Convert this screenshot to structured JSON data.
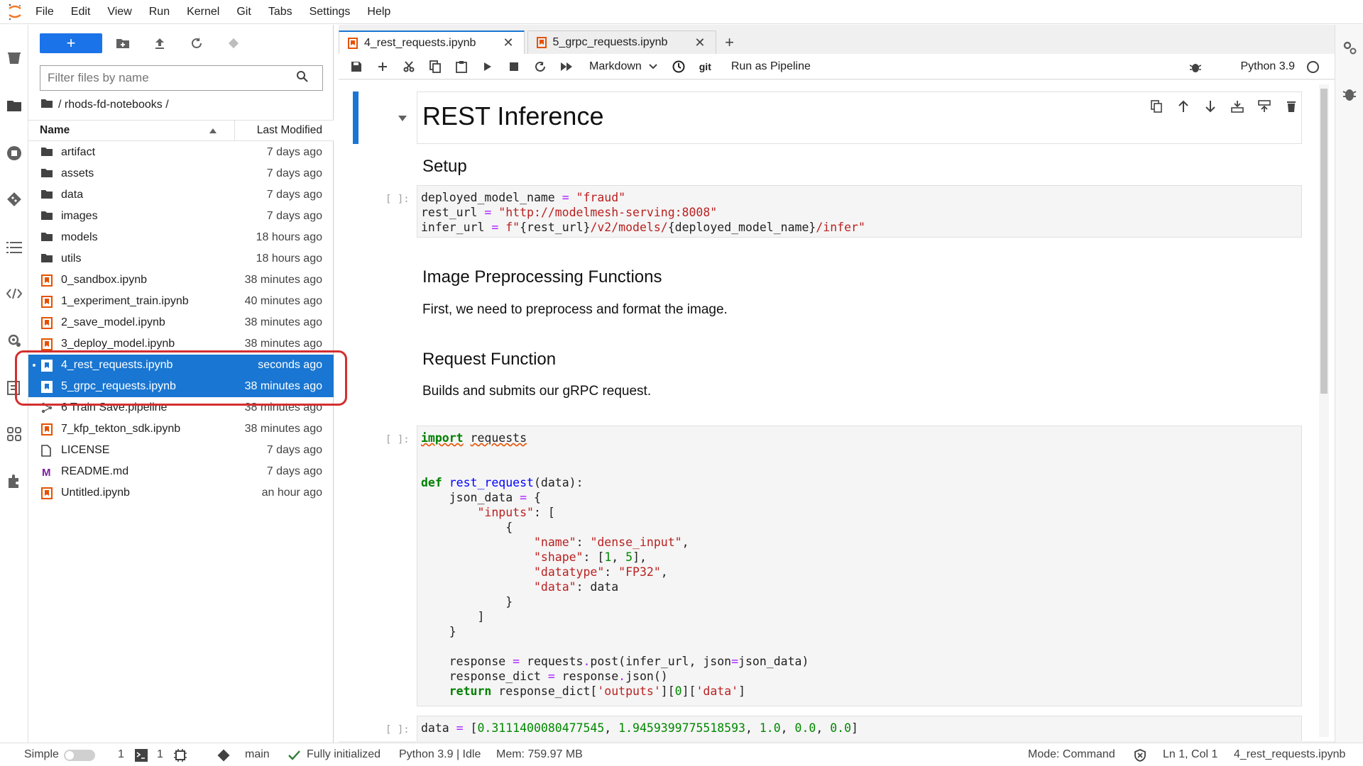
{
  "menu": [
    "File",
    "Edit",
    "View",
    "Run",
    "Kernel",
    "Git",
    "Tabs",
    "Settings",
    "Help"
  ],
  "filebrowser": {
    "new_label": "+",
    "filter_placeholder": "Filter files by name",
    "breadcrumb": "/ rhods-fd-notebooks /",
    "header_name": "Name",
    "header_modified": "Last Modified",
    "items": [
      {
        "name": "artifact",
        "modified": "7 days ago",
        "type": "folder",
        "selected": false
      },
      {
        "name": "assets",
        "modified": "7 days ago",
        "type": "folder",
        "selected": false
      },
      {
        "name": "data",
        "modified": "7 days ago",
        "type": "folder",
        "selected": false
      },
      {
        "name": "images",
        "modified": "7 days ago",
        "type": "folder",
        "selected": false
      },
      {
        "name": "models",
        "modified": "18 hours ago",
        "type": "folder",
        "selected": false
      },
      {
        "name": "utils",
        "modified": "18 hours ago",
        "type": "folder",
        "selected": false
      },
      {
        "name": "0_sandbox.ipynb",
        "modified": "38 minutes ago",
        "type": "notebook",
        "selected": false
      },
      {
        "name": "1_experiment_train.ipynb",
        "modified": "40 minutes ago",
        "type": "notebook",
        "selected": false
      },
      {
        "name": "2_save_model.ipynb",
        "modified": "38 minutes ago",
        "type": "notebook",
        "selected": false
      },
      {
        "name": "3_deploy_model.ipynb",
        "modified": "38 minutes ago",
        "type": "notebook",
        "selected": false
      },
      {
        "name": "4_rest_requests.ipynb",
        "modified": "seconds ago",
        "type": "notebook",
        "selected": true,
        "running": true
      },
      {
        "name": "5_grpc_requests.ipynb",
        "modified": "38 minutes ago",
        "type": "notebook",
        "selected": true
      },
      {
        "name": "6 Train Save.pipeline",
        "modified": "38 minutes ago",
        "type": "pipeline",
        "selected": false
      },
      {
        "name": "7_kfp_tekton_sdk.ipynb",
        "modified": "38 minutes ago",
        "type": "notebook",
        "selected": false
      },
      {
        "name": "LICENSE",
        "modified": "7 days ago",
        "type": "file",
        "selected": false
      },
      {
        "name": "README.md",
        "modified": "7 days ago",
        "type": "markdown",
        "selected": false
      },
      {
        "name": "Untitled.ipynb",
        "modified": "an hour ago",
        "type": "notebook",
        "selected": false
      }
    ]
  },
  "tabs": [
    {
      "label": "4_rest_requests.ipynb",
      "active": true
    },
    {
      "label": "5_grpc_requests.ipynb",
      "active": false
    }
  ],
  "notebook_toolbar": {
    "cell_type": "Markdown",
    "git_label": "git",
    "run_pipeline": "Run as Pipeline",
    "kernel": "Python 3.9"
  },
  "notebook": {
    "title": "REST Inference",
    "setup": "Setup",
    "prompt": "[ ]:",
    "img_heading": "Image Preprocessing Functions",
    "img_text": "First, we need to preprocess and format the image.",
    "req_heading": "Request Function",
    "req_text": "Builds and submits our gRPC request."
  },
  "status": {
    "mode_label": "Simple",
    "terminals": "1",
    "kernels": "1",
    "branch": "main",
    "init": "Fully initialized",
    "kernel_state": "Python 3.9 | Idle",
    "mem": "Mem: 759.97 MB",
    "mode": "Mode: Command",
    "position": "Ln 1, Col 1",
    "file": "4_rest_requests.ipynb"
  },
  "colors": {
    "accent": "#1976d2",
    "selection": "#1976d2",
    "highlight": "#d32f2f",
    "notebook_icon": "#e65100"
  }
}
